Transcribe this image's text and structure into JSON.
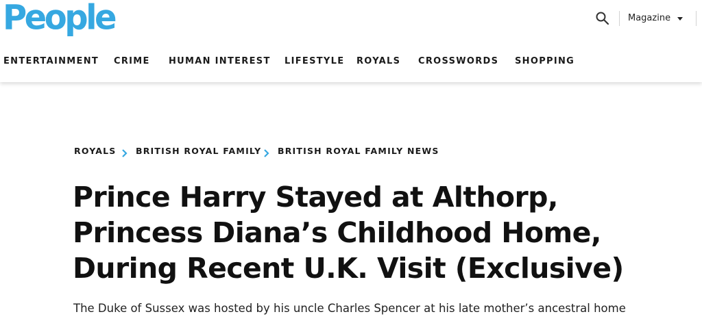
{
  "header": {
    "logo_text": "People",
    "brand_color": "#36a8e1",
    "search_icon": "search-icon",
    "magazine_label": "Magazine"
  },
  "nav": {
    "items": [
      {
        "label": "ENTERTAINMENT"
      },
      {
        "label": "CRIME"
      },
      {
        "label": "HUMAN INTEREST"
      },
      {
        "label": "LIFESTYLE"
      },
      {
        "label": "ROYALS"
      },
      {
        "label": "CROSSWORDS"
      },
      {
        "label": "SHOPPING"
      }
    ]
  },
  "article": {
    "breadcrumb": [
      {
        "label": "ROYALS"
      },
      {
        "label": "BRITISH ROYAL FAMILY"
      },
      {
        "label": "BRITISH ROYAL FAMILY NEWS"
      }
    ],
    "breadcrumb_separator_color": "#36a8e1",
    "headline": "Prince Harry Stayed at Althorp, Princess Diana’s Childhood Home, During Recent U.K. Visit (Exclusive)",
    "dek": "The Duke of Sussex was hosted by his uncle Charles Spencer at his late mother’s ancestral home"
  }
}
